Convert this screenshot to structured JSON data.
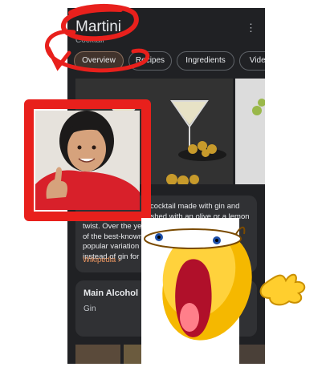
{
  "header": {
    "title": "Martini",
    "subtitle": "Cocktail",
    "more_icon": "more-vert-icon"
  },
  "tabs": [
    {
      "label": "Overview",
      "active": true
    },
    {
      "label": "Recipes",
      "active": false
    },
    {
      "label": "Ingredients",
      "active": false
    },
    {
      "label": "Videos",
      "active": false
    }
  ],
  "description": {
    "lines": [
      "cocktail made with gin and",
      "vermouth, and garnished with an olive or a lemon",
      "twist. Over the years, the martini became one",
      "of the best-known",
      "popular variation",
      "instead of gin for t"
    ],
    "link": "Wikipedia ›"
  },
  "facts": {
    "label": "Main Alcohol",
    "value": "Gin"
  },
  "colors": {
    "background": "#202124",
    "card": "#303134",
    "accent": "#f29962",
    "annotation": "#e8201c"
  },
  "stickers": [
    "girl-thumbs-up-photo",
    "shocked-emoji-sticker"
  ]
}
